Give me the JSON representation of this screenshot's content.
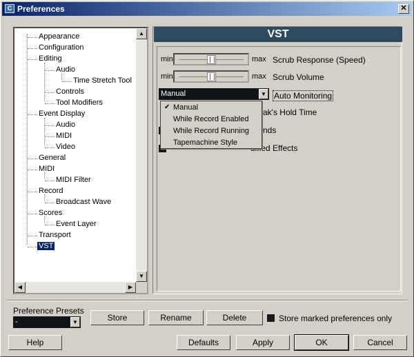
{
  "window": {
    "title": "Preferences"
  },
  "tree": {
    "items": [
      {
        "label": "Appearance"
      },
      {
        "label": "Configuration"
      },
      {
        "label": "Editing"
      },
      {
        "label": "Audio"
      },
      {
        "label": "Time Stretch Tool"
      },
      {
        "label": "Controls"
      },
      {
        "label": "Tool Modifiers"
      },
      {
        "label": "Event Display"
      },
      {
        "label": "Audio"
      },
      {
        "label": "MIDI"
      },
      {
        "label": "Video"
      },
      {
        "label": "General"
      },
      {
        "label": "MIDI"
      },
      {
        "label": "MIDI Filter"
      },
      {
        "label": "Record"
      },
      {
        "label": "Broadcast Wave"
      },
      {
        "label": "Scores"
      },
      {
        "label": "Event Layer"
      },
      {
        "label": "Transport"
      },
      {
        "label": "VST"
      }
    ],
    "selected": "VST"
  },
  "panel": {
    "title": "VST",
    "scrub_response": {
      "min": "min",
      "max": "max",
      "label": "Scrub Response (Speed)",
      "value": 0.5
    },
    "scrub_volume": {
      "min": "min",
      "max": "max",
      "label": "Scrub Volume",
      "value": 0.5
    },
    "auto_monitoring": {
      "value": "Manual",
      "label": "Auto Monitoring"
    },
    "peak_hold_partial": "ak's Hold Time",
    "sends_partial": "nds",
    "effects_partial": "dified Effects",
    "dropdown_options": [
      "Manual",
      "While Record Enabled",
      "While Record Running",
      "Tapemachine Style"
    ]
  },
  "presets": {
    "label": "Preference Presets",
    "value": "-",
    "store": "Store",
    "rename": "Rename",
    "delete": "Delete",
    "store_marked": "Store marked preferences only"
  },
  "buttons": {
    "help": "Help",
    "defaults": "Defaults",
    "apply": "Apply",
    "ok": "OK",
    "cancel": "Cancel"
  },
  "colors": {
    "titlebar": "#0a246a",
    "header": "#2d4a5e",
    "selection": "#0a246a"
  }
}
